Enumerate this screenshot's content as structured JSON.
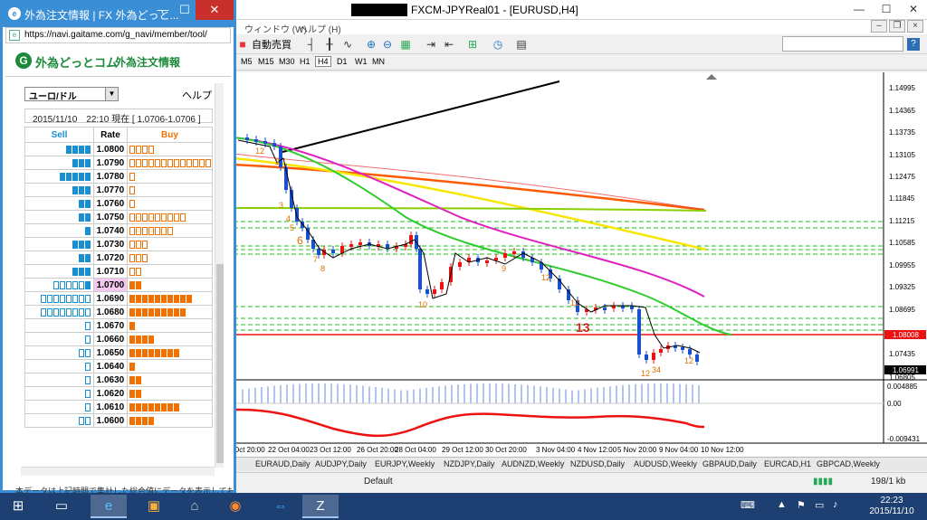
{
  "mt4": {
    "title": "FXCM-JPYReal01 - [EURUSD,H4]",
    "menu": [
      "ウィンドウ (W)",
      "ヘルプ (H)"
    ],
    "autotrade_label": "自動売買",
    "timeframes": [
      "M5",
      "M15",
      "M30",
      "H1",
      "H4",
      "D1",
      "W1",
      "MN"
    ],
    "active_timeframe": "H4",
    "price_ticks": [
      "1.14995",
      "1.14365",
      "1.13735",
      "1.13105",
      "1.12475",
      "1.11845",
      "1.11215",
      "1.10585",
      "1.09955",
      "1.09325",
      "1.08695",
      "1.08008",
      "1.07435",
      "1.06991",
      "1.06805"
    ],
    "indicator_ticks": [
      "0.004885",
      "0.00",
      "-0.009431"
    ],
    "date_ticks": [
      "Oct 20:00",
      "22 Oct 04:00",
      "23 Oct 12:00",
      "26 Oct 20:00",
      "28 Oct 04:00",
      "29 Oct 12:00",
      "30 Oct 20:00",
      "3 Nov 04:00",
      "4 Nov 12:00",
      "5 Nov 20:00",
      "9 Nov 04:00",
      "10 Nov 12:00"
    ],
    "count_labels": [
      "12",
      "2",
      "3",
      "4",
      "5",
      "6",
      "7",
      "8",
      "9",
      "10",
      "11",
      "12",
      "9",
      "12",
      "12",
      "13",
      "12",
      "34",
      "12"
    ],
    "big_label": "13",
    "tabs": [
      "EURAUD,Daily",
      "AUDJPY,Daily",
      "EURJPY,Weekly",
      "NZDJPY,Daily",
      "AUDNZD,Weekly",
      "NZDUSD,Daily",
      "AUDUSD,Weekly",
      "GBPAUD,Daily",
      "EURCAD,H1",
      "GBPCAD,Weekly"
    ],
    "status_profile": "Default",
    "status_traffic": "198/1 kb"
  },
  "gaitame": {
    "title": "外為注文情報 | FX 外為どっと...",
    "url": "https://navi.gaitame.com/g_navi/member/tool/",
    "brand": "外為どっとコム",
    "subtitle": "外為注文情報",
    "pair": "ユーロ/ドル",
    "help": "ヘルプ",
    "rate_line": "2015/11/10　22:10 現在 [ 1.0706-1.0706 ]",
    "headers": {
      "sell": "Sell",
      "rate": "Rate",
      "buy": "Buy"
    },
    "current_rate": "1.0700",
    "rows": [
      {
        "rate": "1.0800",
        "sell_filled": 4,
        "sell_open": 0,
        "buy_filled": 0,
        "buy_open": 4
      },
      {
        "rate": "1.0790",
        "sell_filled": 3,
        "sell_open": 0,
        "buy_filled": 0,
        "buy_open": 13
      },
      {
        "rate": "1.0780",
        "sell_filled": 5,
        "sell_open": 0,
        "buy_filled": 0,
        "buy_open": 1
      },
      {
        "rate": "1.0770",
        "sell_filled": 3,
        "sell_open": 0,
        "buy_filled": 0,
        "buy_open": 1
      },
      {
        "rate": "1.0760",
        "sell_filled": 2,
        "sell_open": 0,
        "buy_filled": 0,
        "buy_open": 1
      },
      {
        "rate": "1.0750",
        "sell_filled": 2,
        "sell_open": 0,
        "buy_filled": 0,
        "buy_open": 9
      },
      {
        "rate": "1.0740",
        "sell_filled": 1,
        "sell_open": 0,
        "buy_filled": 0,
        "buy_open": 7
      },
      {
        "rate": "1.0730",
        "sell_filled": 3,
        "sell_open": 0,
        "buy_filled": 0,
        "buy_open": 3
      },
      {
        "rate": "1.0720",
        "sell_filled": 2,
        "sell_open": 0,
        "buy_filled": 0,
        "buy_open": 3
      },
      {
        "rate": "1.0710",
        "sell_filled": 3,
        "sell_open": 0,
        "buy_filled": 0,
        "buy_open": 2
      },
      {
        "rate": "1.0700",
        "sell_filled": 1,
        "sell_open": 5,
        "buy_filled": 2,
        "buy_open": 0
      },
      {
        "rate": "1.0690",
        "sell_filled": 0,
        "sell_open": 8,
        "buy_filled": 10,
        "buy_open": 0
      },
      {
        "rate": "1.0680",
        "sell_filled": 0,
        "sell_open": 8,
        "buy_filled": 9,
        "buy_open": 0
      },
      {
        "rate": "1.0670",
        "sell_filled": 0,
        "sell_open": 1,
        "buy_filled": 1,
        "buy_open": 0
      },
      {
        "rate": "1.0660",
        "sell_filled": 0,
        "sell_open": 1,
        "buy_filled": 4,
        "buy_open": 0
      },
      {
        "rate": "1.0650",
        "sell_filled": 0,
        "sell_open": 2,
        "buy_filled": 8,
        "buy_open": 0
      },
      {
        "rate": "1.0640",
        "sell_filled": 0,
        "sell_open": 1,
        "buy_filled": 1,
        "buy_open": 0
      },
      {
        "rate": "1.0630",
        "sell_filled": 0,
        "sell_open": 1,
        "buy_filled": 2,
        "buy_open": 0
      },
      {
        "rate": "1.0620",
        "sell_filled": 0,
        "sell_open": 1,
        "buy_filled": 2,
        "buy_open": 0
      },
      {
        "rate": "1.0610",
        "sell_filled": 0,
        "sell_open": 1,
        "buy_filled": 8,
        "buy_open": 0
      },
      {
        "rate": "1.0600",
        "sell_filled": 0,
        "sell_open": 2,
        "buy_filled": 4,
        "buy_open": 0
      }
    ],
    "footer": "本データは上記時間で集計した総合値にデータを表示しております"
  },
  "taskbar": {
    "time": "22:23",
    "date": "2015/11/10"
  },
  "colors": {
    "sell": "#1a8fd0",
    "buy": "#f07000",
    "accent": "#3a8ed6",
    "current_row": "#f4c8ef"
  }
}
